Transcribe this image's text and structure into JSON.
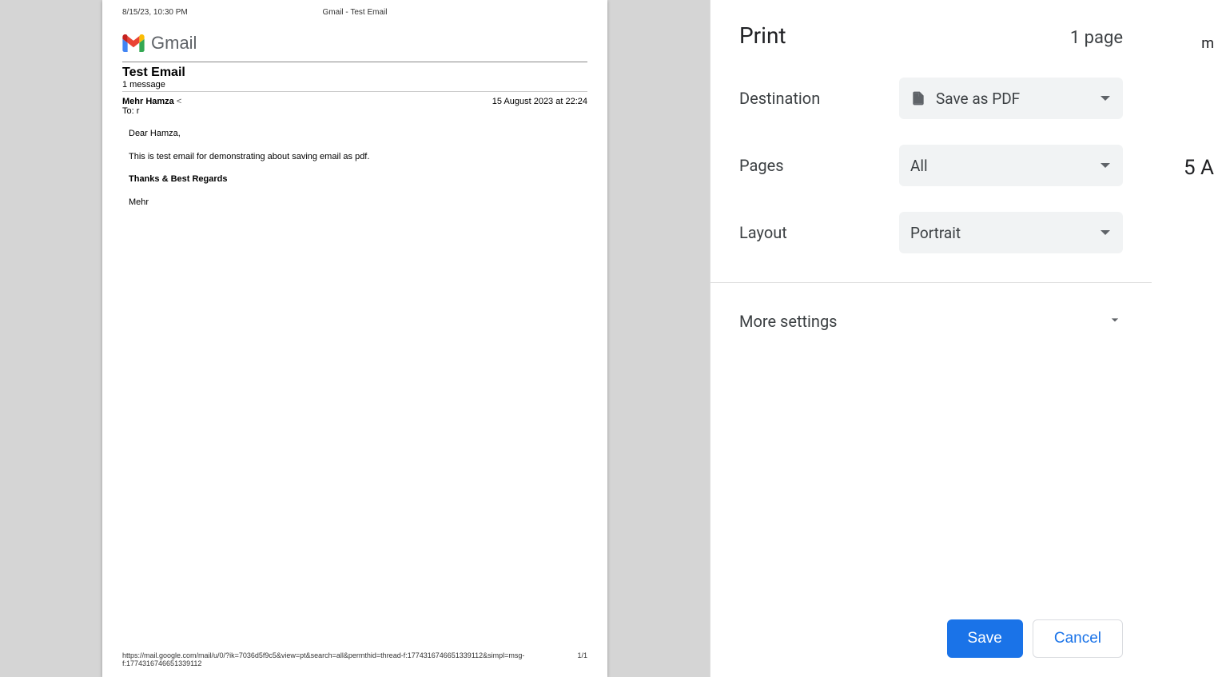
{
  "preview": {
    "header_left": "8/15/23, 10:30 PM",
    "header_center": "Gmail - Test Email",
    "logo_text": "Gmail",
    "from_obscured_top": "",
    "subject": "Test Email",
    "message_count": "1 message",
    "sender_name": "Mehr Hamza",
    "sender_email": "<",
    "date": "15 August 2023 at 22:24",
    "to_line": "To: r",
    "body_greeting": "Dear Hamza,",
    "body_text": "This is test email for demonstrating about saving email as pdf.",
    "body_regards": "Thanks & Best Regards",
    "body_signature": "Mehr",
    "footer_url": "https://mail.google.com/mail/u/0/?ik=7036d5f9c5&view=pt&search=all&permthid=thread-f:1774316746651339112&simpl=msg-f:1774316746651339112",
    "footer_page": "1/1"
  },
  "panel": {
    "title": "Print",
    "page_count": "1 page",
    "destination_label": "Destination",
    "destination_value": "Save as PDF",
    "pages_label": "Pages",
    "pages_value": "All",
    "layout_label": "Layout",
    "layout_value": "Portrait",
    "more_settings": "More settings",
    "save_label": "Save",
    "cancel_label": "Cancel"
  },
  "background": {
    "line1": "m",
    "line2": "5 A"
  }
}
